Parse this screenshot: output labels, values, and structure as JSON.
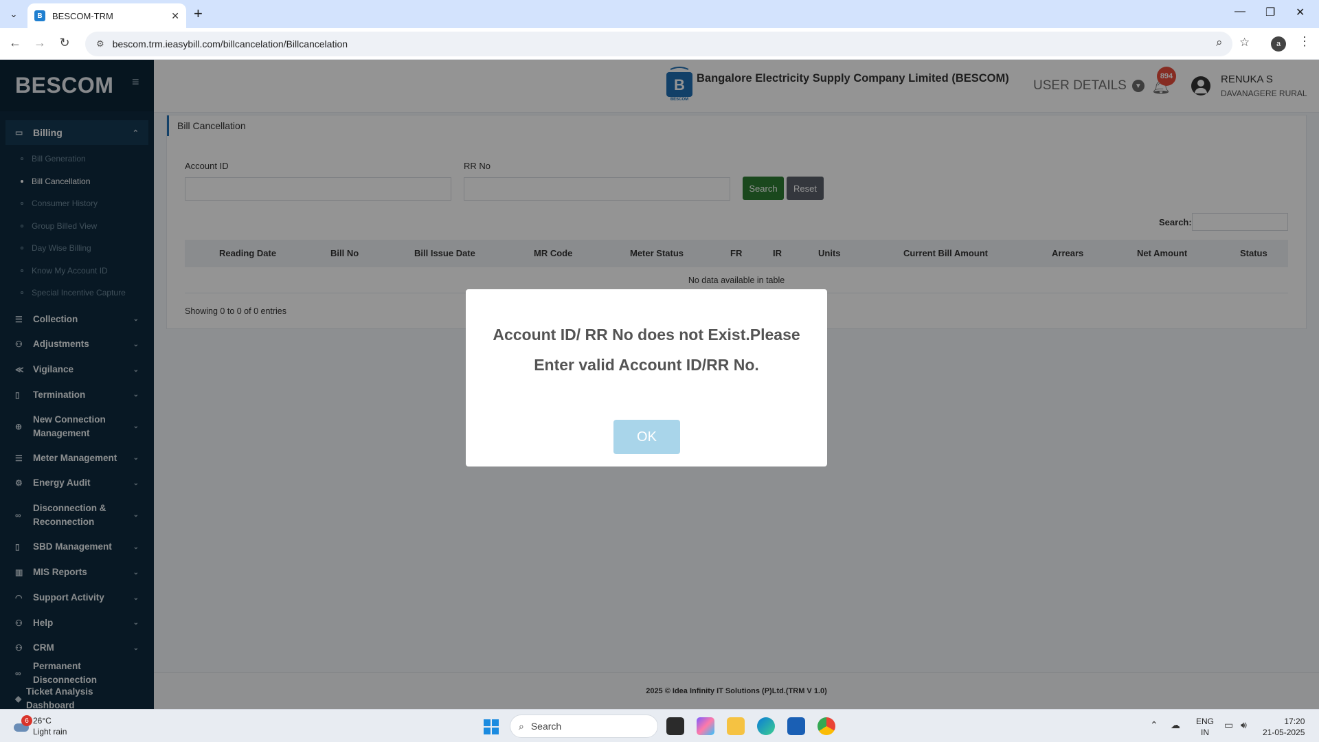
{
  "browser": {
    "tab_title": "BESCOM-TRM",
    "url": "bescom.trm.ieasybill.com/billcancelation/Billcancelation"
  },
  "sidebar": {
    "brand": "BESCOM",
    "billing": "Billing",
    "submenu": [
      "Bill Generation",
      "Bill Cancellation",
      "Consumer History",
      "Group Billed View",
      "Day Wise Billing",
      "Know My Account ID",
      "Special Incentive Capture"
    ],
    "menu": [
      "Collection",
      "Adjustments",
      "Vigilance",
      "Termination",
      "New Connection Management",
      "Meter Management",
      "Energy Audit",
      "Disconnection & Reconnection",
      "SBD Management",
      "MIS Reports",
      "Support Activity",
      "Help",
      "CRM",
      "Permanent Disconnection",
      "Ticket Analysis Dashboard"
    ]
  },
  "header": {
    "logo_text": "BESCOM",
    "company": "Bangalore Electricity Supply Company Limited (BESCOM)",
    "user_details": "USER DETAILS",
    "notifications": "894",
    "user_name": "RENUKA S",
    "user_location": "DAVANAGERE RURAL"
  },
  "page": {
    "title": "Bill Cancellation",
    "account_label": "Account ID",
    "rr_label": "RR No",
    "search_btn": "Search",
    "reset_btn": "Reset",
    "search_label": "Search:",
    "columns": [
      "Reading Date",
      "Bill No",
      "Bill Issue Date",
      "MR Code",
      "Meter Status",
      "FR",
      "IR",
      "Units",
      "Current Bill Amount",
      "Arrears",
      "Net Amount",
      "Status"
    ],
    "no_data": "No data available in table",
    "showing": "Showing 0 to 0 of 0 entries"
  },
  "footer": "2025 © Idea Infinity IT Solutions (P)Ltd.(TRM V 1.0)",
  "modal": {
    "message": "Account ID/ RR No does not Exist.Please Enter valid Account ID/RR No.",
    "ok": "OK"
  },
  "taskbar": {
    "weather_badge": "6",
    "temp": "26°C",
    "weather": "Light rain",
    "search": "Search",
    "lang1": "ENG",
    "lang2": "IN",
    "time": "17:20",
    "date": "21-05-2025"
  }
}
